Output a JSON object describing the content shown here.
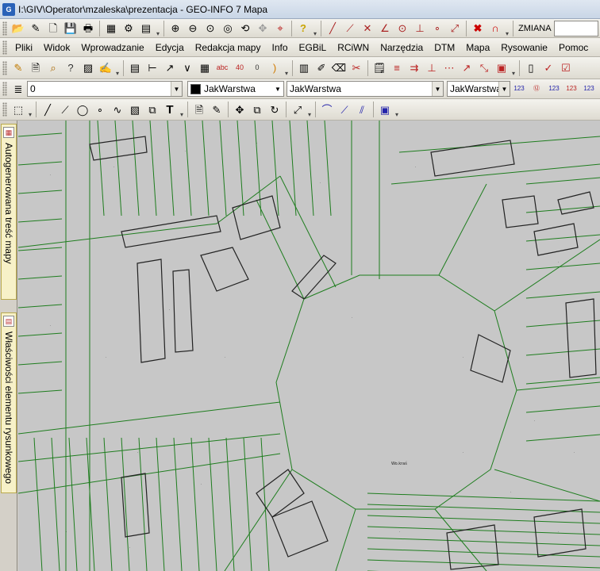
{
  "window": {
    "title": "I:\\GIV\\Operator\\mzaleska\\prezentacja - GEO-INFO 7 Mapa"
  },
  "toolbar1": {
    "zmiana_label": "ZMIANA"
  },
  "menu": [
    {
      "label": "Pliki"
    },
    {
      "label": "Widok"
    },
    {
      "label": "Wprowadzanie"
    },
    {
      "label": "Edycja"
    },
    {
      "label": "Redakcja mapy"
    },
    {
      "label": "Info"
    },
    {
      "label": "EGBiL"
    },
    {
      "label": "RCiWN"
    },
    {
      "label": "Narzędzia"
    },
    {
      "label": "DTM"
    },
    {
      "label": "Mapa"
    },
    {
      "label": "Rysowanie"
    },
    {
      "label": "Pomoc"
    }
  ],
  "layer_bar": {
    "layer_value": "0",
    "color_label": "JakWarstwa",
    "linetype_value": "JakWarstwa",
    "lineweight_value": "JakWarstwa",
    "accent_color": "#000000"
  },
  "side_panel": {
    "tab1_label": "Autogenerowana treść mapy",
    "tab2_label": "Właściwości elementu rysunkowego"
  },
  "map": {
    "background_color": "#c7c7c7",
    "parcel_line_color": "#1e7d1e",
    "building_line_color": "#222222",
    "center_label": "Wo.kraś"
  }
}
